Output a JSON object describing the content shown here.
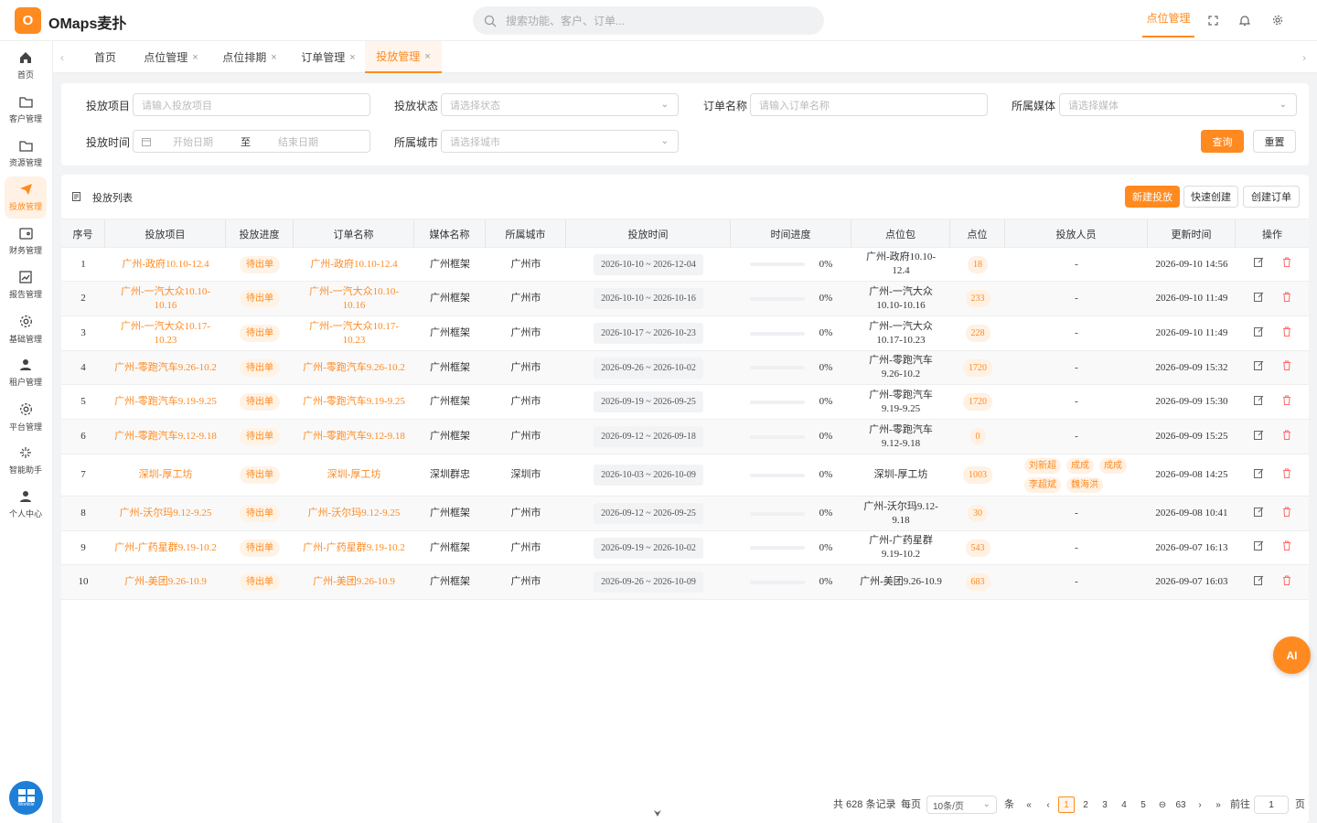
{
  "app": {
    "logo_letter": "O",
    "name": "OMaps麦扑"
  },
  "search": {
    "placeholder": "搜索功能、客户、订单..."
  },
  "topbar": {
    "active_link": "点位管理"
  },
  "sidebar": {
    "items": [
      {
        "label": "首页",
        "icon": "home-icon"
      },
      {
        "label": "客户管理",
        "icon": "folder-icon"
      },
      {
        "label": "资源管理",
        "icon": "folder-icon"
      },
      {
        "label": "投放管理",
        "icon": "send-icon",
        "active": true
      },
      {
        "label": "财务管理",
        "icon": "wallet-icon"
      },
      {
        "label": "报告管理",
        "icon": "chart-icon"
      },
      {
        "label": "基础管理",
        "icon": "gear-icon"
      },
      {
        "label": "租户管理",
        "icon": "user-icon"
      },
      {
        "label": "平台管理",
        "icon": "gear-icon"
      },
      {
        "label": "智能助手",
        "icon": "sparkle-icon"
      },
      {
        "label": "个人中心",
        "icon": "user-icon"
      }
    ],
    "worktile": "Worktile"
  },
  "tabs": [
    {
      "label": "首页",
      "closable": false
    },
    {
      "label": "点位管理",
      "closable": true
    },
    {
      "label": "点位排期",
      "closable": true
    },
    {
      "label": "订单管理",
      "closable": true
    },
    {
      "label": "投放管理",
      "closable": true,
      "active": true
    }
  ],
  "filter": {
    "project_label": "投放项目",
    "project_placeholder": "请输入投放项目",
    "status_label": "投放状态",
    "status_placeholder": "请选择状态",
    "order_label": "订单名称",
    "order_placeholder": "请输入订单名称",
    "media_label": "所属媒体",
    "media_placeholder": "请选择媒体",
    "time_label": "投放时间",
    "start_placeholder": "开始日期",
    "range_sep": "至",
    "end_placeholder": "结束日期",
    "city_label": "所属城市",
    "city_placeholder": "请选择城市",
    "query_button": "查询",
    "reset_button": "重置"
  },
  "list": {
    "title": "投放列表",
    "new_button": "新建投放",
    "quick_button": "快速创建",
    "create_order_button": "创建订单",
    "columns": [
      "序号",
      "投放项目",
      "投放进度",
      "订单名称",
      "媒体名称",
      "所属城市",
      "投放时间",
      "时间进度",
      "点位包",
      "点位",
      "投放人员",
      "更新时间",
      "操作"
    ],
    "rows": [
      {
        "no": "1",
        "project": "广州-政府10.10-12.4",
        "status": "待出单",
        "order": "广州-政府10.10-12.4",
        "media": "广州框架",
        "city": "广州市",
        "time": "2026-10-10 ~ 2026-12-04",
        "progress_pct": "0%",
        "progress": 0,
        "package": "广州-政府10.10-12.4",
        "points": "18",
        "people": [],
        "people_text": "-",
        "updated": "2026-09-10 14:56"
      },
      {
        "no": "2",
        "project": "广州-一汽大众10.10-10.16",
        "status": "待出单",
        "order": "广州-一汽大众10.10-10.16",
        "media": "广州框架",
        "city": "广州市",
        "time": "2026-10-10 ~ 2026-10-16",
        "progress_pct": "0%",
        "progress": 0,
        "package": "广州-一汽大众10.10-10.16",
        "points": "233",
        "people": [],
        "people_text": "-",
        "updated": "2026-09-10 11:49"
      },
      {
        "no": "3",
        "project": "广州-一汽大众10.17-10.23",
        "status": "待出单",
        "order": "广州-一汽大众10.17-10.23",
        "media": "广州框架",
        "city": "广州市",
        "time": "2026-10-17 ~ 2026-10-23",
        "progress_pct": "0%",
        "progress": 0,
        "package": "广州-一汽大众10.17-10.23",
        "points": "228",
        "people": [],
        "people_text": "-",
        "updated": "2026-09-10 11:49"
      },
      {
        "no": "4",
        "project": "广州-零跑汽车9.26-10.2",
        "status": "待出单",
        "order": "广州-零跑汽车9.26-10.2",
        "media": "广州框架",
        "city": "广州市",
        "time": "2026-09-26 ~ 2026-10-02",
        "progress_pct": "0%",
        "progress": 0,
        "package": "广州-零跑汽车9.26-10.2",
        "points": "1720",
        "people": [],
        "people_text": "-",
        "updated": "2026-09-09 15:32"
      },
      {
        "no": "5",
        "project": "广州-零跑汽车9.19-9.25",
        "status": "待出单",
        "order": "广州-零跑汽车9.19-9.25",
        "media": "广州框架",
        "city": "广州市",
        "time": "2026-09-19 ~ 2026-09-25",
        "progress_pct": "0%",
        "progress": 0,
        "package": "广州-零跑汽车9.19-9.25",
        "points": "1720",
        "people": [],
        "people_text": "-",
        "updated": "2026-09-09 15:30"
      },
      {
        "no": "6",
        "project": "广州-零跑汽车9.12-9.18",
        "status": "待出单",
        "order": "广州-零跑汽车9.12-9.18",
        "media": "广州框架",
        "city": "广州市",
        "time": "2026-09-12 ~ 2026-09-18",
        "progress_pct": "0%",
        "progress": 0,
        "package": "广州-零跑汽车9.12-9.18",
        "points": "0",
        "people": [],
        "people_text": "-",
        "updated": "2026-09-09 15:25"
      },
      {
        "no": "7",
        "project": "深圳-厚工坊",
        "status": "待出单",
        "order": "深圳-厚工坊",
        "media": "深圳群忠",
        "city": "深圳市",
        "time": "2026-10-03 ~ 2026-10-09",
        "progress_pct": "0%",
        "progress": 0,
        "package": "深圳-厚工坊",
        "points": "1003",
        "people": [
          "刘新超",
          "成成",
          "成成",
          "李超斌",
          "魏海洪"
        ],
        "people_text": "",
        "updated": "2026-09-08 14:25"
      },
      {
        "no": "8",
        "project": "广州-沃尔玛9.12-9.25",
        "status": "待出单",
        "order": "广州-沃尔玛9.12-9.25",
        "media": "广州框架",
        "city": "广州市",
        "time": "2026-09-12 ~ 2026-09-25",
        "progress_pct": "0%",
        "progress": 0,
        "package": "广州-沃尔玛9.12-9.18",
        "points": "30",
        "people": [],
        "people_text": "-",
        "updated": "2026-09-08 10:41"
      },
      {
        "no": "9",
        "project": "广州-广药星群9.19-10.2",
        "status": "待出单",
        "order": "广州-广药星群9.19-10.2",
        "media": "广州框架",
        "city": "广州市",
        "time": "2026-09-19 ~ 2026-10-02",
        "progress_pct": "0%",
        "progress": 0,
        "package": "广州-广药星群9.19-10.2",
        "points": "543",
        "people": [],
        "people_text": "-",
        "updated": "2026-09-07 16:13"
      },
      {
        "no": "10",
        "project": "广州-美团9.26-10.9",
        "status": "待出单",
        "order": "广州-美团9.26-10.9",
        "media": "广州框架",
        "city": "广州市",
        "time": "2026-09-26 ~ 2026-10-09",
        "progress_pct": "0%",
        "progress": 0,
        "package": "广州-美团9.26-10.9",
        "points": "683",
        "people": [],
        "people_text": "-",
        "updated": "2026-09-07 16:03"
      }
    ]
  },
  "pagination": {
    "total_text": "共 628 条记录",
    "per_page_label": "每页",
    "page_size": "10条/页",
    "unit": "条",
    "pages": [
      "1",
      "2",
      "3",
      "4",
      "5"
    ],
    "current": "1",
    "last": "63",
    "goto_label": "前往",
    "goto_value": "1",
    "page_unit": "页"
  },
  "ai_button": "AI",
  "colors": {
    "accent": "#ff8a1f",
    "accent_bg": "#fff1e3",
    "delete": "#ff6b6b"
  }
}
